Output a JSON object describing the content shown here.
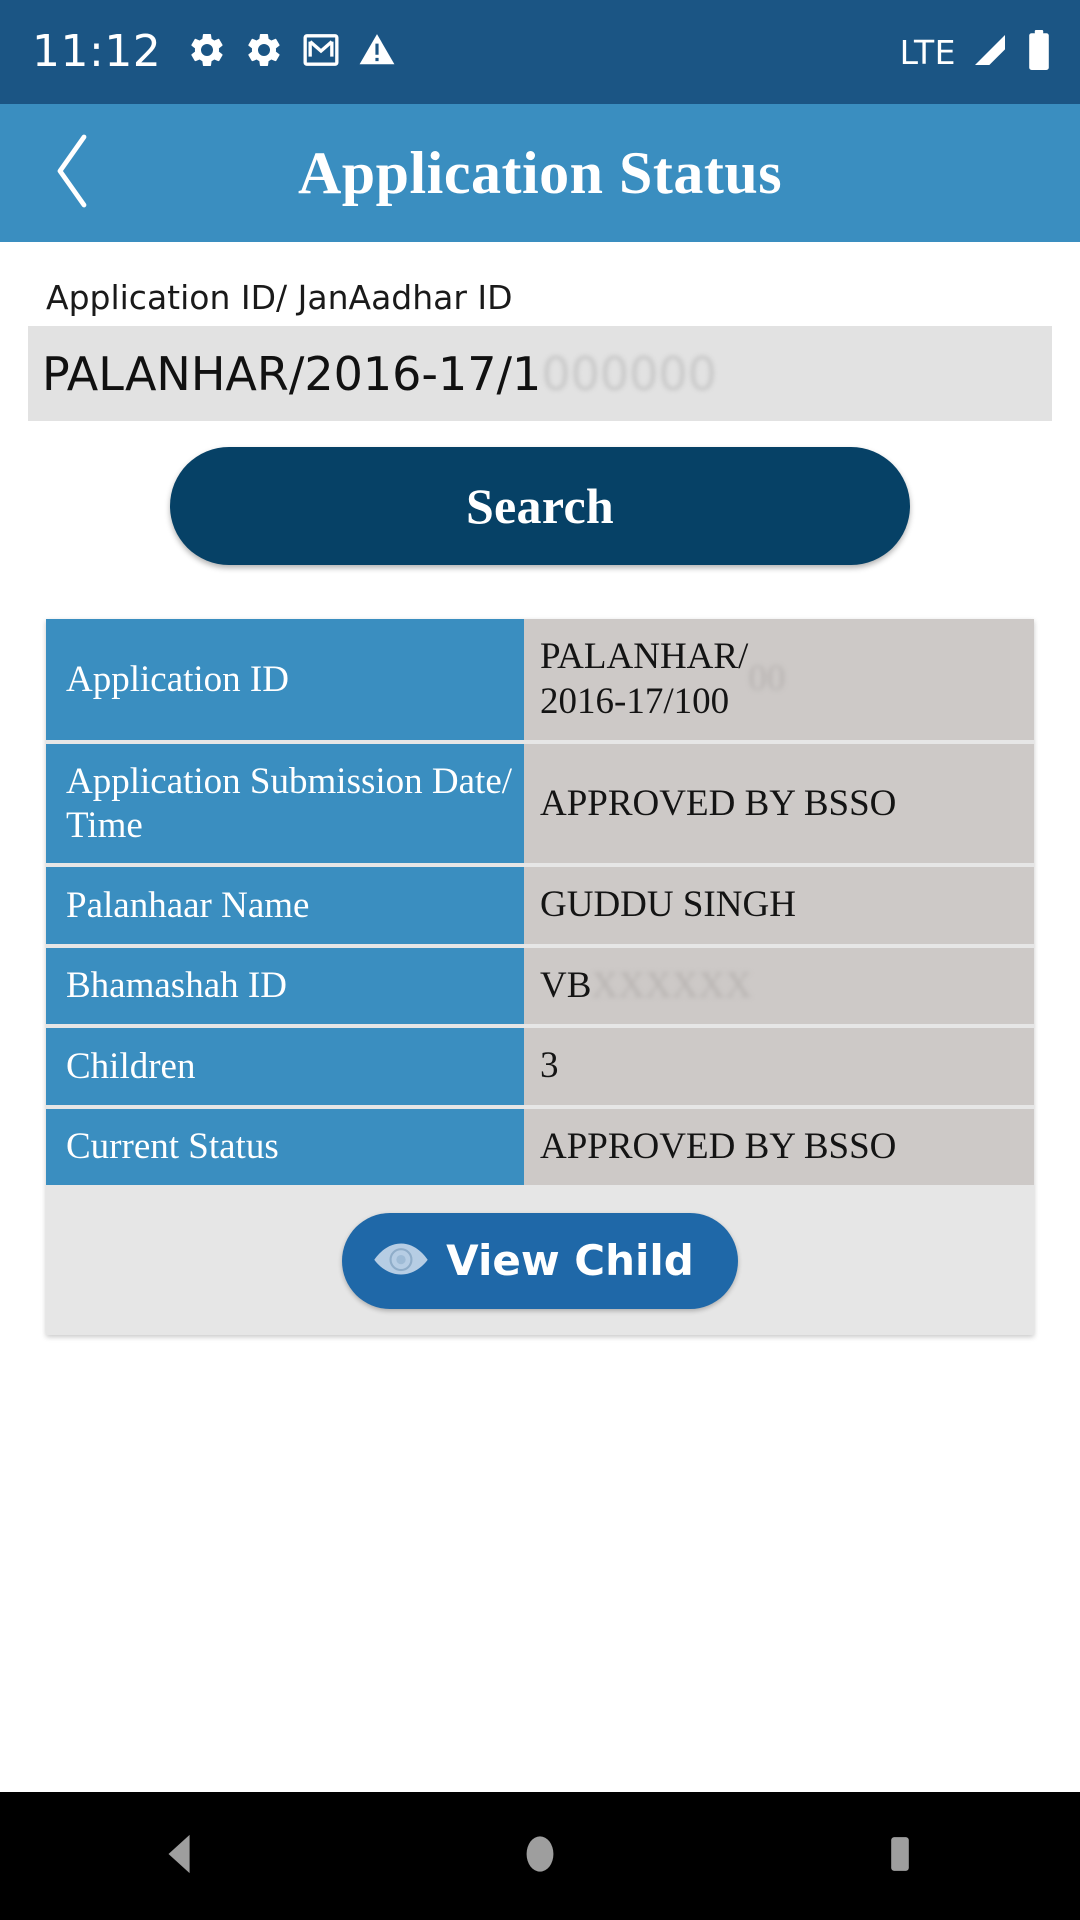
{
  "statusbar": {
    "time": "11:12",
    "network_label": "LTE",
    "icons": [
      "settings-gear-icon",
      "settings-gear-icon",
      "gmail-icon",
      "warning-triangle-icon"
    ],
    "right_icons": [
      "signal-bars-icon",
      "battery-full-icon"
    ],
    "background_color": "#1b5584"
  },
  "appbar": {
    "title": "Application Status",
    "back_icon": "chevron-left-icon",
    "background_color": "#3a8ec0"
  },
  "search_form": {
    "label": "Application ID/ JanAadhar ID",
    "value_visible": "PALANHAR/2016-17/1",
    "value_redacted": "000000",
    "placeholder": "Application ID/ JanAadhar ID",
    "search_button_label": "Search",
    "search_button_color": "#064166"
  },
  "result": {
    "rows": [
      {
        "label": "Application ID",
        "value": "PALANHAR/\n2016-17/100",
        "value_redacted": "00",
        "size": "tall"
      },
      {
        "label": "Application Submission Date/ Time",
        "value": "APPROVED BY BSSO",
        "value_redacted": "",
        "size": "tall"
      },
      {
        "label": "Palanhaar Name",
        "value": "GUDDU SINGH",
        "value_redacted": "",
        "size": "short"
      },
      {
        "label": "Bhamashah ID",
        "value": "VB",
        "value_redacted": "XXXXXX",
        "size": "short"
      },
      {
        "label": "Children",
        "value": "3",
        "value_redacted": "",
        "size": "short"
      },
      {
        "label": "Current Status",
        "value": "APPROVED BY BSSO",
        "value_redacted": "",
        "size": "short"
      }
    ],
    "label_color": "#3a8ec0",
    "value_color": "#cdc9c7",
    "view_child_label": "View Child",
    "view_child_icon": "eye-icon",
    "view_child_color": "#1f68a8"
  },
  "navbar": {
    "back_icon": "nav-back-triangle-icon",
    "home_icon": "nav-home-circle-icon",
    "recents_icon": "nav-recents-square-icon",
    "background_color": "#000000"
  }
}
